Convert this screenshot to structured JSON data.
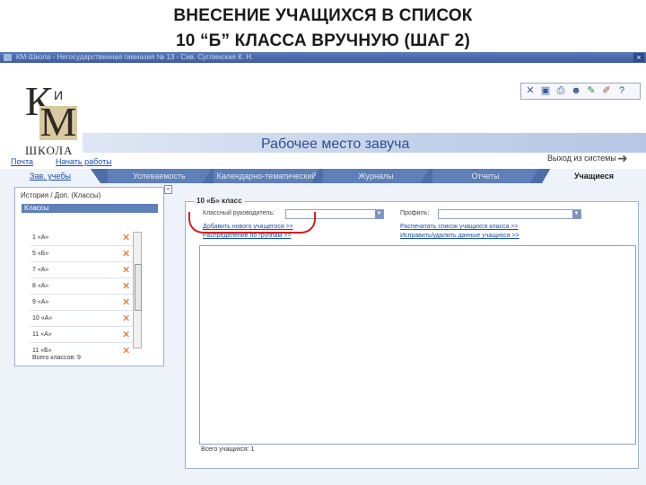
{
  "slide": {
    "title_line1": "ВНЕСЕНИЕ  УЧАЩИХСЯ В СПИСОК",
    "title_line2": "10 “Б” КЛАССА ВРУЧНУЮ (ШАГ 2)"
  },
  "window": {
    "title": "КМ-Школа - Негосударственная гимназия № 13 - Сев. Суглинская К. Н.",
    "close_label": "×"
  },
  "toolbar": {
    "icons": [
      "close-icon",
      "save-icon",
      "print-icon",
      "users-icon",
      "edit-icon",
      "pen-icon",
      "help-icon"
    ],
    "glyphs": [
      "✕",
      "▣",
      "⎙",
      "☻",
      "✎",
      "✐",
      "?"
    ]
  },
  "logo": {
    "letter_k": "К",
    "letter_m": "М",
    "letter_i": "И",
    "caption": "ШКОЛА"
  },
  "header": {
    "workplace": "Рабочее место завуча",
    "nav_home": "Почта",
    "nav_start": "Начать работы",
    "logout": "Выход из системы"
  },
  "tabs": [
    "Зав. учебы",
    "Успеваемость",
    "Календарно-тематический",
    "Журналы",
    "Отчеты",
    "Учащиеся"
  ],
  "classes_panel": {
    "title": "История / Доп. (Классы)",
    "header": "Классы",
    "rows": [
      "1 «А»",
      "5 «Б»",
      "7 «А»",
      "8 «А»",
      "9 «А»",
      "10 «А»",
      "11 «А»",
      "11 «Б»"
    ],
    "total": "Всего классов: 9"
  },
  "class_panel": {
    "legend": "10 «Б» класс",
    "teacher_label": "Классный руководитель:",
    "profile_label": "Профиль:",
    "add_student": "Добавить нового учащегося >>",
    "print_list": "Распечатать список учащихся класса >>",
    "distribution": "Распределение по группам >>",
    "cancel_marks": "Исправить/удалить данные учащихся >>",
    "total_students": "Всего учащихся: 1"
  },
  "colors": {
    "accent": "#5f7fb8",
    "link": "#1a4fb2",
    "delete": "#e0661e",
    "annotation": "#d22020"
  }
}
